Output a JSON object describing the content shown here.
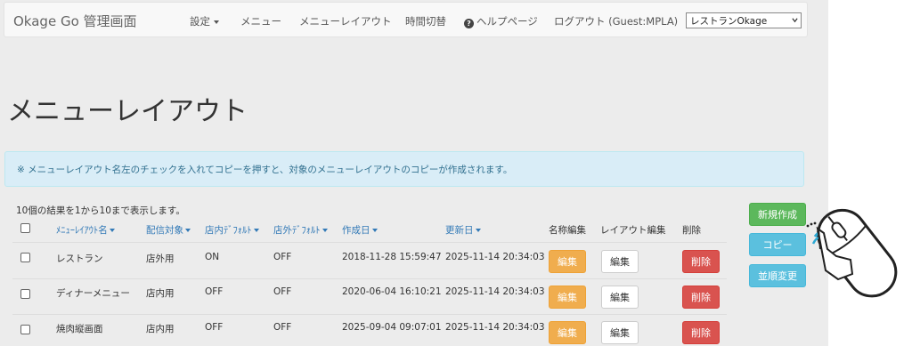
{
  "navbar": {
    "brand": "Okage Go 管理画面",
    "items": [
      "設定",
      "メニュー",
      "メニューレイアウト",
      "時間切替",
      "ヘルプページ",
      "ログアウト (Guest:MPLA)"
    ],
    "help_icon_glyph": "?",
    "store_select_value": "レストランOkage"
  },
  "page": {
    "title": "メニューレイアウト",
    "info_message": "※ メニューレイアウト名左のチェックを入れてコピーを押すと、対象のメニューレイアウトのコピーが作成されます。",
    "result_count": "10個の結果を1から10まで表示します。"
  },
  "table": {
    "columns": [
      "ﾒﾆｭｰﾚｲｱｳﾄ名",
      "配信対象",
      "店内ﾃﾞﾌｫﾙﾄ",
      "店外ﾃﾞﾌｫﾙﾄ",
      "作成日",
      "更新日",
      "名称編集",
      "レイアウト編集",
      "削除"
    ],
    "rows": [
      {
        "name": "レストラン",
        "target": "店外用",
        "in_default": "ON",
        "out_default": "OFF",
        "created": "2018-11-28 15:59:47",
        "updated": "2025-11-14 20:34:03"
      },
      {
        "name": "ディナーメニュー",
        "target": "店内用",
        "in_default": "OFF",
        "out_default": "OFF",
        "created": "2020-06-04 16:10:21",
        "updated": "2025-11-14 20:34:03"
      },
      {
        "name": "焼肉縦画面",
        "target": "店内用",
        "in_default": "OFF",
        "out_default": "OFF",
        "created": "2025-09-04 09:07:01",
        "updated": "2025-11-14 20:34:03"
      }
    ],
    "edit_name_label": "編集",
    "edit_layout_label": "編集",
    "delete_label": "削除"
  },
  "side_buttons": {
    "create": "新規作成",
    "copy": "コピー",
    "reorder": "並順変更"
  },
  "colors": {
    "link": "#337ab7",
    "warning": "#f0ad4e",
    "danger": "#d9534f",
    "success": "#5cb85c",
    "info": "#5bc0de"
  },
  "icons": [
    "help-icon",
    "mouse-click-icon"
  ]
}
